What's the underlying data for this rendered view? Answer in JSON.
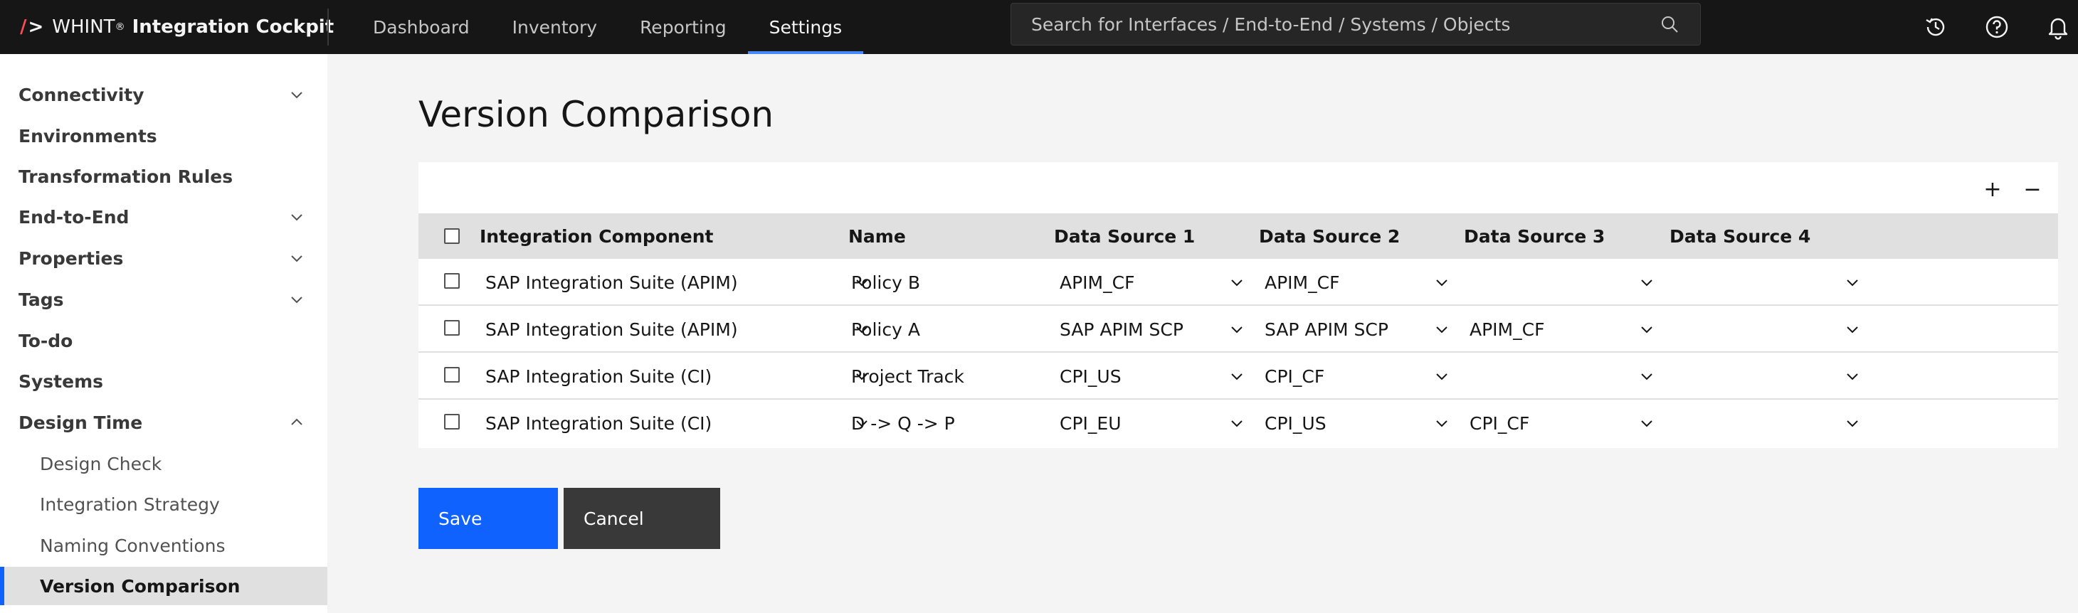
{
  "app": {
    "brand_name": "WHINT",
    "brand_reg": "®",
    "brand_product": "Integration Cockpit"
  },
  "nav": {
    "items": [
      "Dashboard",
      "Inventory",
      "Reporting",
      "Settings"
    ],
    "active": "Settings"
  },
  "search": {
    "placeholder": "Search for Interfaces / End-to-End / Systems / Objects"
  },
  "header_icons": [
    "history-icon",
    "help-icon",
    "notification-bell-icon"
  ],
  "sidebar": {
    "items": [
      {
        "label": "Connectivity",
        "expandable": true,
        "expanded": false
      },
      {
        "label": "Environments",
        "expandable": false
      },
      {
        "label": "Transformation Rules",
        "expandable": false
      },
      {
        "label": "End-to-End",
        "expandable": true,
        "expanded": false
      },
      {
        "label": "Properties",
        "expandable": true,
        "expanded": false
      },
      {
        "label": "Tags",
        "expandable": true,
        "expanded": false
      },
      {
        "label": "To-do",
        "expandable": false
      },
      {
        "label": "Systems",
        "expandable": false
      },
      {
        "label": "Design Time",
        "expandable": true,
        "expanded": true
      }
    ],
    "subitems": [
      "Design Check",
      "Integration Strategy",
      "Naming Conventions",
      "Version Comparison"
    ],
    "active_subitem": "Version Comparison"
  },
  "main": {
    "title": "Version Comparison",
    "toolbar": {
      "add_label": "+",
      "remove_label": "−"
    },
    "columns": [
      "Integration Component",
      "Name",
      "Data Source 1",
      "Data Source 2",
      "Data Source 3",
      "Data Source 4"
    ],
    "rows": [
      {
        "component": "SAP Integration Suite (APIM)",
        "name": "Policy B",
        "ds1": "APIM_CF",
        "ds2": "APIM_CF",
        "ds3": "",
        "ds4": "",
        "checked": false
      },
      {
        "component": "SAP Integration Suite (APIM)",
        "name": "Policy A",
        "ds1": "SAP APIM SCP",
        "ds2": "SAP APIM SCP",
        "ds3": "APIM_CF",
        "ds4": "",
        "checked": false
      },
      {
        "component": "SAP Integration Suite (CI)",
        "name": "Project Track",
        "ds1": "CPI_US",
        "ds2": "CPI_CF",
        "ds3": "",
        "ds4": "",
        "checked": false
      },
      {
        "component": "SAP Integration Suite (CI)",
        "name": "D -> Q -> P",
        "ds1": "CPI_EU",
        "ds2": "CPI_US",
        "ds3": "CPI_CF",
        "ds4": "",
        "checked": false
      }
    ],
    "save_label": "Save",
    "cancel_label": "Cancel"
  },
  "colors": {
    "header_bg": "#161616",
    "accent": "#0f62fe",
    "nav_active_underline": "#4589ff",
    "brand_slash": "#fa4d56",
    "cancel_bg": "#393939"
  }
}
